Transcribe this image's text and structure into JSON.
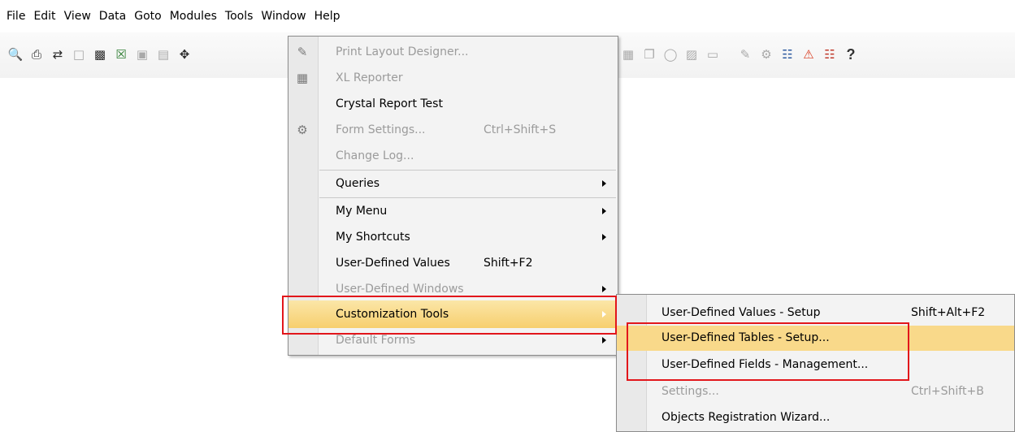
{
  "menubar": {
    "items": [
      {
        "label": "File"
      },
      {
        "label": "Edit"
      },
      {
        "label": "View"
      },
      {
        "label": "Data"
      },
      {
        "label": "Goto"
      },
      {
        "label": "Modules"
      },
      {
        "label": "Tools"
      },
      {
        "label": "Window"
      },
      {
        "label": "Help"
      }
    ]
  },
  "toolbar": {
    "left_icons": [
      "print-preview-icon",
      "print-icon",
      "send-icon",
      "pdf-page-icon",
      "save-icon",
      "excel-icon",
      "word-icon",
      "pdf-icon",
      "navigate-icon"
    ],
    "right_icons": [
      "clipboard-icon",
      "copy-icon",
      "money-icon",
      "document-icon",
      "window-icon",
      "pencil-icon",
      "form-settings-icon",
      "search-icon",
      "alert-icon",
      "calendar-icon",
      "help-icon"
    ],
    "help_glyph": "?"
  },
  "tools_menu": {
    "items": [
      {
        "label": "Print Layout Designer...",
        "shortcut": "",
        "disabled": true
      },
      {
        "label": "XL Reporter",
        "shortcut": "",
        "disabled": true
      },
      {
        "label": "Crystal Report Test",
        "shortcut": "",
        "disabled": false
      },
      {
        "label": "Form Settings...",
        "shortcut": "Ctrl+Shift+S",
        "disabled": true
      },
      {
        "label": "Change Log...",
        "shortcut": "",
        "disabled": true
      },
      {
        "label": "Queries",
        "shortcut": "",
        "disabled": false
      },
      {
        "label": "My Menu",
        "shortcut": "",
        "disabled": false
      },
      {
        "label": "My Shortcuts",
        "shortcut": "",
        "disabled": false
      },
      {
        "label": "User-Defined Values",
        "shortcut": "Shift+F2",
        "disabled": false
      },
      {
        "label": "User-Defined Windows",
        "shortcut": "",
        "disabled": true
      },
      {
        "label": "Customization Tools",
        "shortcut": "",
        "disabled": false
      },
      {
        "label": "Default Forms",
        "shortcut": "",
        "disabled": true
      }
    ]
  },
  "customization_submenu": {
    "items": [
      {
        "label": "User-Defined Values - Setup",
        "shortcut": "Shift+Alt+F2",
        "disabled": false
      },
      {
        "label": "User-Defined Tables - Setup...",
        "shortcut": "",
        "disabled": false
      },
      {
        "label": "User-Defined Fields - Management...",
        "shortcut": "",
        "disabled": false
      },
      {
        "label": "Settings...",
        "shortcut": "Ctrl+Shift+B",
        "disabled": true
      },
      {
        "label": "Objects Registration Wizard...",
        "shortcut": "",
        "disabled": false
      }
    ]
  },
  "colors": {
    "highlight": "#f9d98a",
    "annotation_red": "#e2161b",
    "disabled_text": "#9b9b9b"
  }
}
